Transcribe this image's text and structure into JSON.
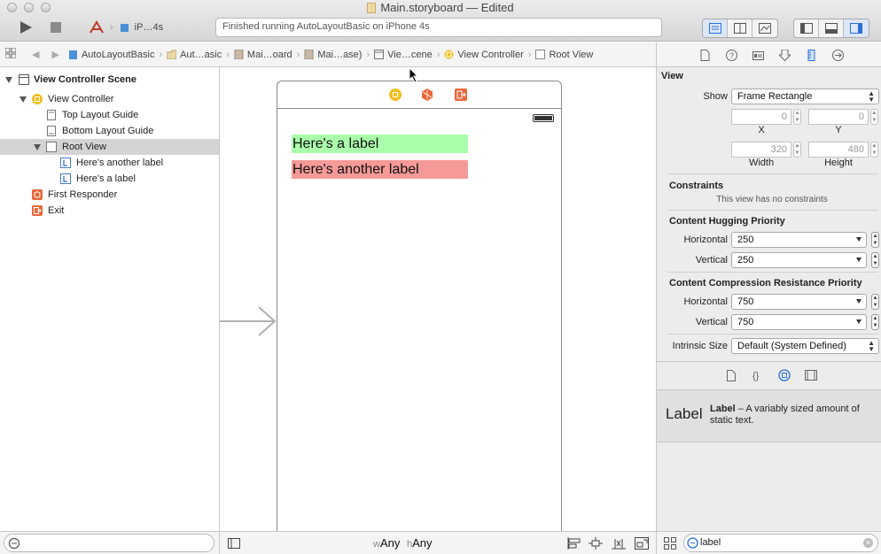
{
  "window": {
    "title": "Main.storyboard — Edited"
  },
  "toolbar": {
    "scheme_device": "iP…4s",
    "status": "Finished running AutoLayoutBasic on iPhone 4s"
  },
  "jumpbar": {
    "items": [
      "AutoLayoutBasic",
      "Aut…asic",
      "Mai…oard",
      "Mai…ase)",
      "Vie…cene",
      "View Controller",
      "Root View"
    ]
  },
  "outline": {
    "scene": "View Controller Scene",
    "view_controller": "View Controller",
    "top_layout_guide": "Top Layout Guide",
    "bottom_layout_guide": "Bottom Layout Guide",
    "root_view": "Root View",
    "label_another": "Here's another label",
    "label_a": "Here's a label",
    "first_responder": "First Responder",
    "exit": "Exit"
  },
  "canvas": {
    "label_green": "Here's a label",
    "label_red": "Here's another label",
    "size_w_prefix": "w",
    "size_w_value": "Any",
    "size_h_prefix": "h",
    "size_h_value": "Any"
  },
  "inspector": {
    "view_title": "View",
    "show_label": "Show",
    "show_value": "Frame Rectangle",
    "x_value": "0",
    "y_value": "0",
    "x_label": "X",
    "y_label": "Y",
    "width_value": "320",
    "height_value": "480",
    "width_label": "Width",
    "height_label": "Height",
    "constraints_title": "Constraints",
    "constraints_note": "This view has no constraints",
    "hugging_title": "Content Hugging Priority",
    "hugging_h_label": "Horizontal",
    "hugging_h_value": "250",
    "hugging_v_label": "Vertical",
    "hugging_v_value": "250",
    "compression_title": "Content Compression Resistance Priority",
    "compression_h_label": "Horizontal",
    "compression_h_value": "750",
    "compression_v_label": "Vertical",
    "compression_v_value": "750",
    "intrinsic_label": "Intrinsic Size",
    "intrinsic_value": "Default (System Defined)"
  },
  "library": {
    "item_big": "Label",
    "item_name": "Label",
    "item_desc": " – A variably sized amount of static text.",
    "search_value": "label"
  },
  "colors": {
    "label_green": "#aaffaa",
    "label_red": "#f59a98",
    "accent_blue": "#2b6fd6",
    "vc_yellow": "#f0c020",
    "orange": "#e8673a"
  }
}
